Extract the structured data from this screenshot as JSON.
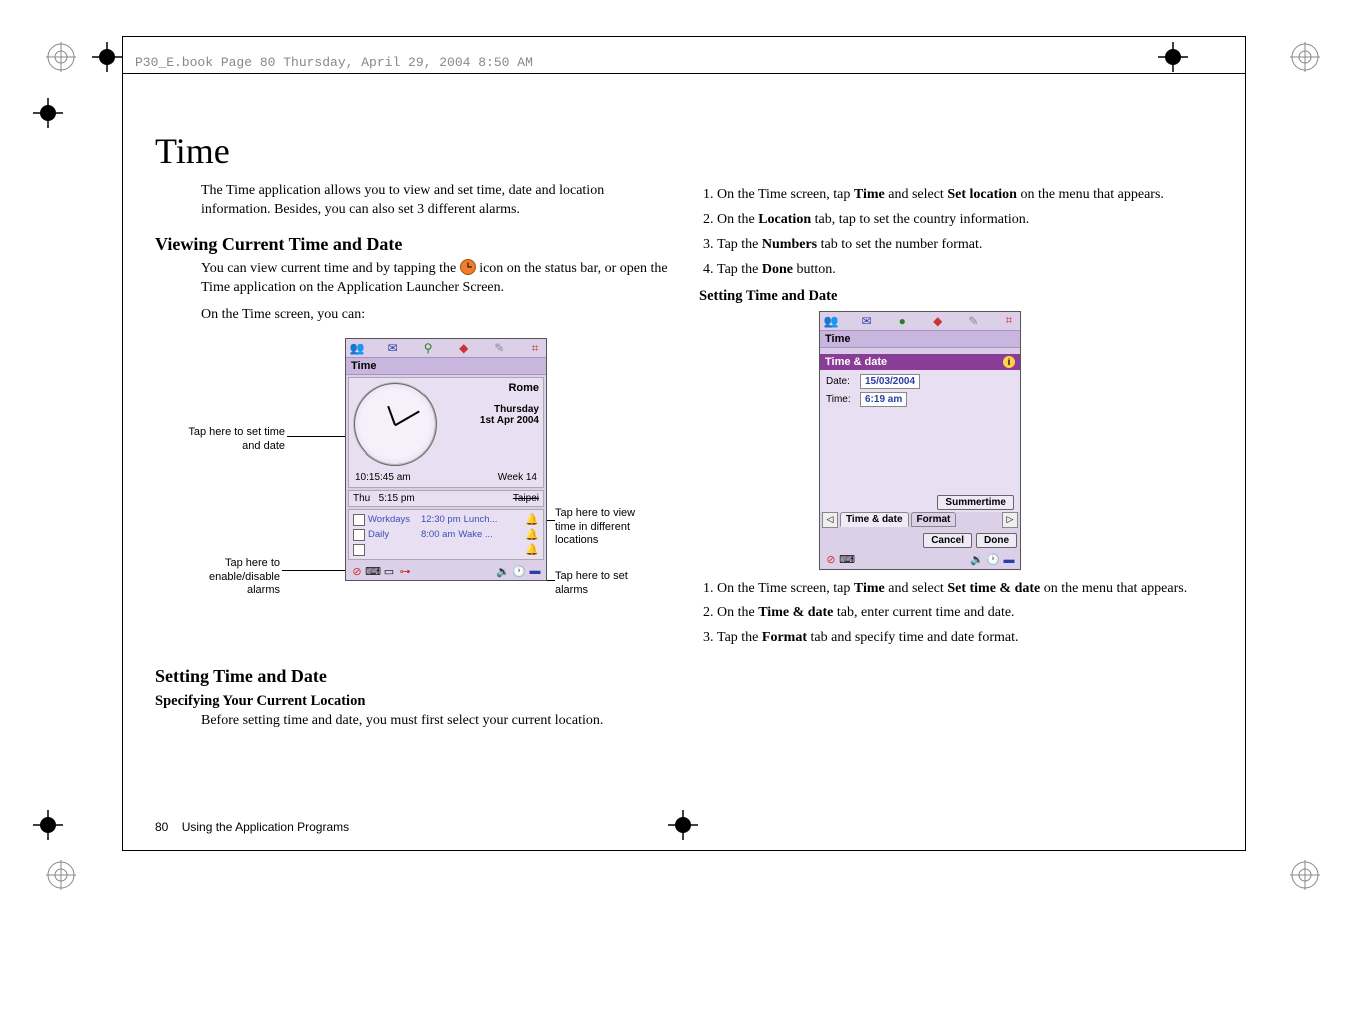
{
  "header": {
    "running": "P30_E.book  Page 80  Thursday, April 29, 2004  8:50 AM"
  },
  "title": "Time",
  "intro": "The Time application allows you to view and set time, date and location information. Besides, you can also set 3 different alarms.",
  "section_view": {
    "heading": "Viewing Current Time and Date",
    "p1a": "You can view current time and by tapping the ",
    "p1b": " icon on the status bar, or open the Time application on the Application Launcher Screen.",
    "p2": "On the Time screen, you can:"
  },
  "fig1": {
    "title": "Time",
    "city": "Rome",
    "day": "Thursday",
    "date": "1st Apr 2004",
    "time": "10:15:45 am",
    "week": "Week 14",
    "loc_day": "Thu",
    "loc_time": "5:15 pm",
    "loc_city": "Taipei",
    "alarm1_label": "Workdays",
    "alarm1_time": "12:30 pm",
    "alarm1_desc": "Lunch...",
    "alarm2_label": "Daily",
    "alarm2_time": "8:00 am",
    "alarm2_desc": "Wake ...",
    "callouts": {
      "set_time": "Tap here to set time and date",
      "view_loc": "Tap here to view time in different locations",
      "enable_alarms": "Tap here to enable/disable alarms",
      "set_alarms": "Tap here to set alarms"
    }
  },
  "section_set": {
    "heading": "Setting Time and Date",
    "sub1": "Specifying Your Current Location",
    "sub1_p": "Before setting time and date, you must first select your current location."
  },
  "right": {
    "step1a": "On the Time screen, tap ",
    "step1b": "Time",
    "step1c": " and select ",
    "step1d": "Set location",
    "step1e": " on the menu that appears.",
    "step2a": "On the ",
    "step2b": "Location",
    "step2c": " tab, tap to set the country information.",
    "step3a": "Tap the ",
    "step3b": "Numbers",
    "step3c": " tab to set the number format.",
    "step4a": "Tap the ",
    "step4b": "Done",
    "step4c": " button.",
    "heading2": "Setting Time and Date"
  },
  "fig2": {
    "title": "Time",
    "tab_header": "Time & date",
    "date_lbl": "Date:",
    "date_val": "15/03/2004",
    "time_lbl": "Time:",
    "time_val": "6:19 am",
    "summertime": "Summertime",
    "tab1": "Time & date",
    "tab2": "Format",
    "cancel": "Cancel",
    "done": "Done"
  },
  "right2": {
    "step1a": "On the Time screen, tap ",
    "step1b": "Time",
    "step1c": " and select ",
    "step1d": "Set time & date",
    "step1e": " on the menu that appears.",
    "step2a": "On the ",
    "step2b": "Time & date",
    "step2c": " tab, enter current time and date.",
    "step3a": "Tap the ",
    "step3b": "Format",
    "step3c": " tab and specify time and date format."
  },
  "footer": {
    "page": "80",
    "chapter": "Using the Application Programs"
  }
}
